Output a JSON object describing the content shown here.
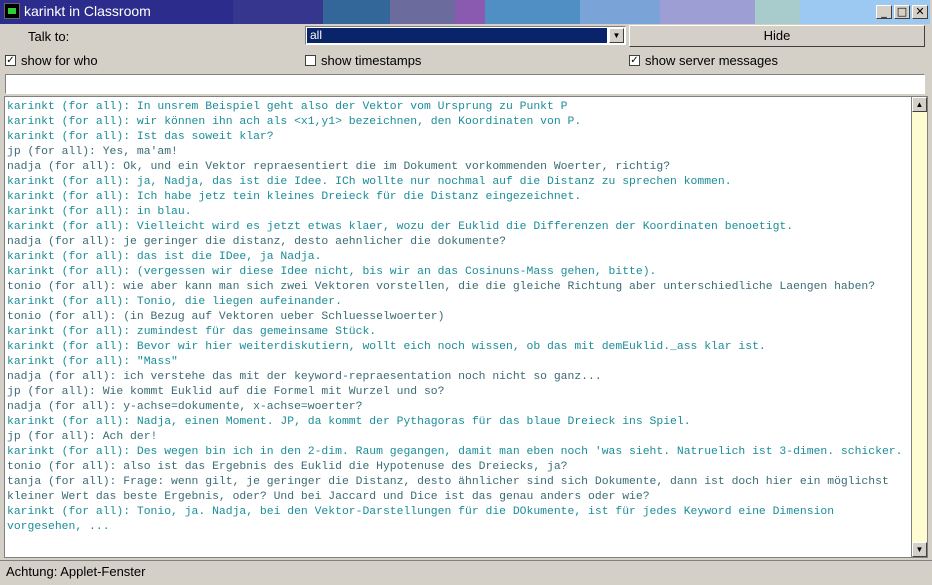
{
  "window": {
    "title": "karinkt in Classroom",
    "min_btn": "_",
    "max_btn": "□",
    "close_btn": "✕"
  },
  "titlebar_colors": [
    "#2c2c8c",
    "#36368f",
    "#336699",
    "#6b6b9e",
    "#8a5ab0",
    "#4f8fc4",
    "#7aa3d8",
    "#9d9fd4",
    "#a8cccc",
    "#9bc9f2"
  ],
  "controls": {
    "talk_to_label": "Talk to:",
    "talk_to_value": "all",
    "hide_label": "Hide",
    "show_for_who": {
      "label": "show for who",
      "checked": true
    },
    "show_timestamps": {
      "label": "show timestamps",
      "checked": false
    },
    "show_server_messages": {
      "label": "show server messages",
      "checked": true
    }
  },
  "message_input": {
    "value": ""
  },
  "messages": [
    {
      "text": "karinkt (for all): In unsrem Beispiel geht also der Vektor vom Ursprung zu Punkt P",
      "color": "teal"
    },
    {
      "text": "karinkt (for all): wir können ihn ach als <x1,y1> bezeichnen, den Koordinaten von P.",
      "color": "teal"
    },
    {
      "text": "karinkt (for all): Ist das soweit klar?",
      "color": "teal"
    },
    {
      "text": "jp (for all): Yes, ma'am!",
      "color": "gray"
    },
    {
      "text": "nadja (for all): Ok, und ein Vektor repraesentiert die im Dokument vorkommenden Woerter, richtig?",
      "color": "gray"
    },
    {
      "text": "karinkt (for all): ja, Nadja, das ist die Idee. ICh wollte nur nochmal auf die Distanz zu sprechen kommen.",
      "color": "teal"
    },
    {
      "text": "karinkt (for all): Ich habe jetz tein kleines Dreieck für die Distanz eingezeichnet.",
      "color": "teal"
    },
    {
      "text": "karinkt (for all): in blau.",
      "color": "teal"
    },
    {
      "text": "karinkt (for all): Vielleicht wird es jetzt etwas klaer, wozu der Euklid die Differenzen der Koordinaten benoetigt.",
      "color": "teal"
    },
    {
      "text": "nadja (for all): je geringer die distanz, desto aehnlicher die dokumente?",
      "color": "gray"
    },
    {
      "text": "karinkt (for all): das ist die IDee, ja Nadja.",
      "color": "teal"
    },
    {
      "text": "karinkt (for all): (vergessen wir diese Idee nicht, bis wir an das Cosinuns-Mass gehen, bitte).",
      "color": "teal"
    },
    {
      "text": "tonio (for all): wie aber kann man sich zwei Vektoren vorstellen, die die gleiche Richtung aber unterschiedliche Laengen haben?",
      "color": "gray"
    },
    {
      "text": "karinkt (for all): Tonio, die liegen aufeinander.",
      "color": "teal"
    },
    {
      "text": "tonio (for all): (in Bezug auf Vektoren ueber Schluesselwoerter)",
      "color": "gray"
    },
    {
      "text": "karinkt (for all): zumindest für das gemeinsame Stück.",
      "color": "teal"
    },
    {
      "text": "karinkt (for all): Bevor wir hier weiterdiskutiern, wollt eich noch wissen, ob das mit demEuklid._ass klar ist.",
      "color": "teal"
    },
    {
      "text": "karinkt (for all): \"Mass\"",
      "color": "teal"
    },
    {
      "text": "nadja (for all): ich verstehe das mit der keyword-repraesentation noch nicht so ganz...",
      "color": "gray"
    },
    {
      "text": "jp (for all): Wie kommt Euklid auf die Formel mit Wurzel und so?",
      "color": "gray"
    },
    {
      "text": "nadja (for all): y-achse=dokumente, x-achse=woerter?",
      "color": "gray"
    },
    {
      "text": "karinkt (for all): Nadja, einen Moment. JP, da kommt der Pythagoras für das blaue Dreieck ins Spiel.",
      "color": "teal"
    },
    {
      "text": "jp (for all): Ach der!",
      "color": "gray"
    },
    {
      "text": "karinkt (for all): Des wegen bin ich in den 2-dim. Raum gegangen, damit man eben noch 'was sieht. Natruelich ist 3-dimen. schicker.",
      "color": "teal"
    },
    {
      "text": "tonio (for all): also ist das Ergebnis des Euklid die Hypotenuse des Dreiecks, ja?",
      "color": "gray"
    },
    {
      "text": "tanja (for all): Frage: wenn gilt, je geringer die Distanz, desto ähnlicher sind sich Dokumente, dann ist doch hier ein möglichst kleiner Wert das beste Ergebnis, oder? Und bei Jaccard und Dice ist das genau anders oder wie?",
      "color": "gray"
    },
    {
      "text": "karinkt (for all): Tonio, ja. Nadja, bei den Vektor-Darstellungen für die DOkumente, ist für jedes Keyword eine Dimension vorgesehen, ...",
      "color": "teal"
    }
  ],
  "scrollbar": {
    "up_arrow": "▲",
    "down_arrow": "▼"
  },
  "status_bar": {
    "text": "Achtung: Applet-Fenster"
  }
}
